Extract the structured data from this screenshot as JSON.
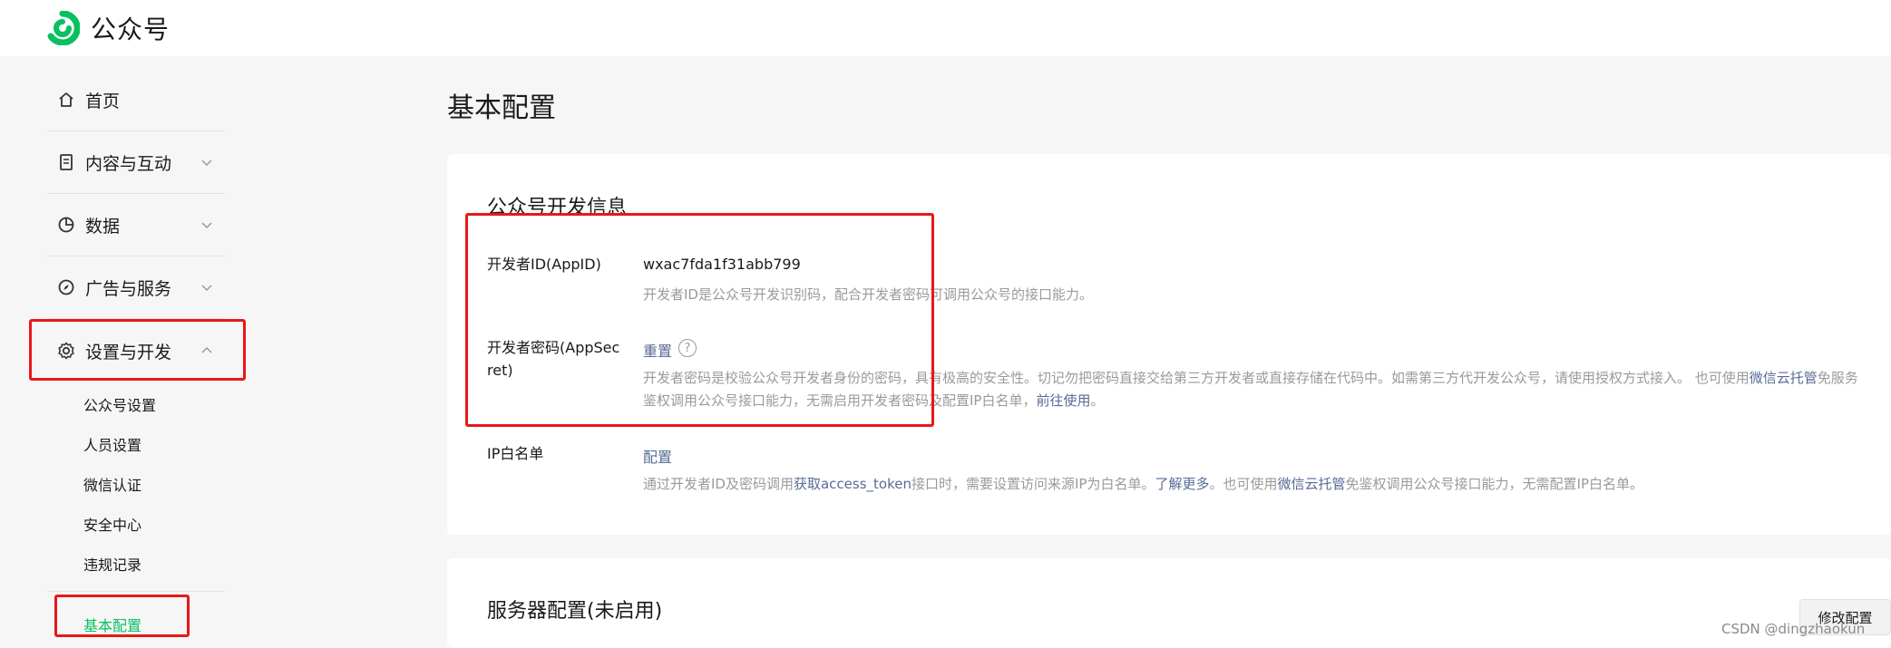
{
  "header": {
    "app_title": "公众号"
  },
  "sidebar": {
    "items": [
      {
        "label": "首页",
        "icon": "home-icon"
      },
      {
        "label": "内容与互动",
        "icon": "document-icon"
      },
      {
        "label": "数据",
        "icon": "pie-chart-icon"
      },
      {
        "label": "广告与服务",
        "icon": "compass-icon"
      },
      {
        "label": "设置与开发",
        "icon": "gear-icon",
        "expanded": true
      }
    ],
    "sub_items": [
      {
        "label": "公众号设置"
      },
      {
        "label": "人员设置"
      },
      {
        "label": "微信认证"
      },
      {
        "label": "安全中心"
      },
      {
        "label": "违规记录"
      },
      {
        "label": "基本配置",
        "active": true
      }
    ]
  },
  "main": {
    "page_title": "基本配置",
    "dev_info": {
      "title": "公众号开发信息",
      "appid": {
        "label": "开发者ID(AppID)",
        "value": "wxac7fda1f31abb799",
        "desc": "开发者ID是公众号开发识别码，配合开发者密码可调用公众号的接口能力。"
      },
      "secret": {
        "label_line1": "开发者密码(AppSec",
        "label_line2": "ret)",
        "action": "重置",
        "help": "?",
        "desc1": "开发者密码是校验公众号开发者身份的密码，具有极高的安全性。切记勿把密码直接交给第三方开发者或直接存储在代码中。如需第三方代开发公众号，请使用授权方式接入。 也可使用",
        "desc1_link": "微信云托管",
        "desc1_tail": "免服务",
        "desc2": "鉴权调用公众号接口能力，无需启用开发者密码及配置IP白名单，",
        "desc2_link": "前往使用",
        "desc2_tail": "。"
      },
      "ip": {
        "label": "IP白名单",
        "action": "配置",
        "desc_a": "通过开发者ID及密码调用",
        "desc_link1": "获取access_token",
        "desc_b": "接口时，需要设置访问来源IP为白名单。",
        "desc_link2": "了解更多",
        "desc_c": "。也可使用",
        "desc_link3": "微信云托管",
        "desc_d": "免鉴权调用公众号接口能力，无需配置IP白名单。"
      }
    },
    "server": {
      "title": "服务器配置(未启用)",
      "edit_button": "修改配置"
    },
    "watermark": "CSDN @dingzhaokun"
  },
  "colors": {
    "accent": "#07c160",
    "link": "#576b95",
    "highlight": "#e81818"
  }
}
